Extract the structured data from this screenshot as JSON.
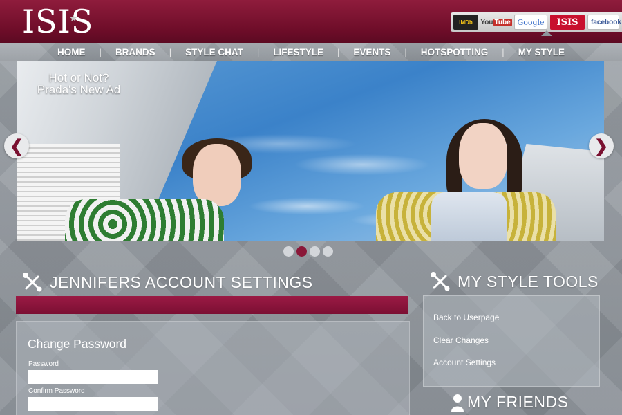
{
  "header": {
    "logo": "ISIS",
    "sites": {
      "imdb": "IMDb",
      "youtube_you": "You",
      "youtube_tube": "Tube",
      "google": "Google",
      "isis": "ISIS",
      "facebook": "facebook"
    }
  },
  "nav": {
    "items": [
      "HOME",
      "BRANDS",
      "STYLE CHAT",
      "LIFESTYLE",
      "EVENTS",
      "HOTSPOTTING",
      "MY STYLE"
    ]
  },
  "hero": {
    "caption_line1": "Hot or Not?",
    "caption_line2": "Prada's New Ad",
    "prev": "❮",
    "next": "❯",
    "dots_count": 4,
    "active_dot": 2
  },
  "account": {
    "title": "JENNIFERS ACCOUNT SETTINGS",
    "change_password_title": "Change Password",
    "password_label": "Password",
    "password_value": "",
    "confirm_label": "Confirm Password",
    "confirm_value": ""
  },
  "tools": {
    "title": "MY STYLE TOOLS",
    "links": [
      "Back to Userpage",
      "Clear Changes",
      "Account Settings"
    ]
  },
  "friends": {
    "title": "MY FRIENDS"
  },
  "colors": {
    "brand": "#7b0f33",
    "active_dot": "#8a1738",
    "background": "#8e949b"
  }
}
